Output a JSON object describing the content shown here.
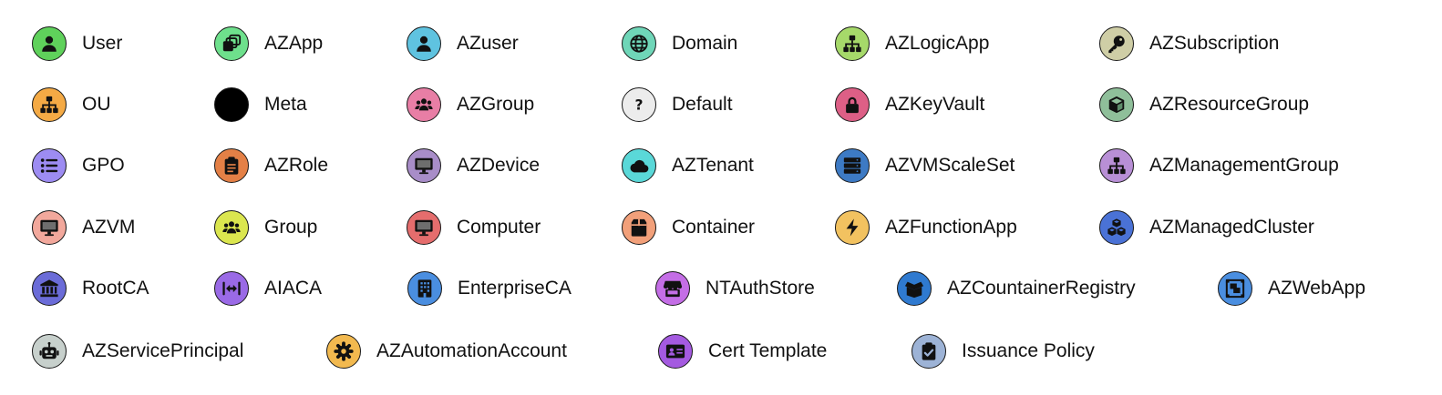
{
  "items": [
    {
      "label": "User",
      "icon": "user-icon",
      "color": "#5fd15b"
    },
    {
      "label": "AZApp",
      "icon": "app-windows-icon",
      "color": "#6ee08c"
    },
    {
      "label": "AZuser",
      "icon": "user-icon",
      "color": "#5fc3e0"
    },
    {
      "label": "Domain",
      "icon": "globe-icon",
      "color": "#6fd6b8"
    },
    {
      "label": "AZLogicApp",
      "icon": "sitemap-icon",
      "color": "#a6d96a"
    },
    {
      "label": "AZSubscription",
      "icon": "key-icon",
      "color": "#cfcea6"
    },
    {
      "label": "OU",
      "icon": "sitemap-icon",
      "color": "#f4aa45"
    },
    {
      "label": "Meta",
      "icon": "none",
      "color": "#000000"
    },
    {
      "label": "AZGroup",
      "icon": "users-icon",
      "color": "#e87ea5"
    },
    {
      "label": "Default",
      "icon": "question-icon",
      "color": "#ececec"
    },
    {
      "label": "AZKeyVault",
      "icon": "lock-icon",
      "color": "#dd5f86"
    },
    {
      "label": "AZResourceGroup",
      "icon": "cube-icon",
      "color": "#8fbf9a"
    },
    {
      "label": "GPO",
      "icon": "list-icon",
      "color": "#9d8cf2"
    },
    {
      "label": "AZRole",
      "icon": "clipboard-icon",
      "color": "#e48046"
    },
    {
      "label": "AZDevice",
      "icon": "desktop-icon",
      "color": "#a88dc8"
    },
    {
      "label": "AZTenant",
      "icon": "cloud-icon",
      "color": "#5ad8d8"
    },
    {
      "label": "AZVMScaleSet",
      "icon": "server-icon",
      "color": "#3d7ac4"
    },
    {
      "label": "AZManagementGroup",
      "icon": "sitemap-icon",
      "color": "#b88fd6"
    },
    {
      "label": "AZVM",
      "icon": "desktop-icon",
      "color": "#f2a89c"
    },
    {
      "label": "Group",
      "icon": "users-icon",
      "color": "#dbe64f"
    },
    {
      "label": "Computer",
      "icon": "desktop-icon",
      "color": "#e56d6d"
    },
    {
      "label": "Container",
      "icon": "box-icon",
      "color": "#f2a07a"
    },
    {
      "label": "AZFunctionApp",
      "icon": "bolt-icon",
      "color": "#f2c260"
    },
    {
      "label": "AZManagedCluster",
      "icon": "cubes-icon",
      "color": "#4a72d6"
    },
    {
      "label": "RootCA",
      "icon": "bank-icon",
      "color": "#6b6cd8"
    },
    {
      "label": "AIACA",
      "icon": "arrows-h-icon",
      "color": "#9a6ae6"
    },
    {
      "label": "EnterpriseCA",
      "icon": "building-icon",
      "color": "#4a8ee0"
    },
    {
      "label": "NTAuthStore",
      "icon": "store-icon",
      "color": "#c46ee6"
    },
    {
      "label": "AZCountainerRegistry",
      "icon": "box-open-icon",
      "color": "#2f7ad0"
    },
    {
      "label": "AZWebApp",
      "icon": "object-group-icon",
      "color": "#4a8ee0"
    },
    {
      "label": "AZServicePrincipal",
      "icon": "robot-icon",
      "color": "#c7d0cc"
    },
    {
      "label": "AZAutomationAccount",
      "icon": "gear-icon",
      "color": "#f2b94f"
    },
    {
      "label": "Cert Template",
      "icon": "id-card-icon",
      "color": "#a45ae0"
    },
    {
      "label": "Issuance Policy",
      "icon": "clipboard-check-icon",
      "color": "#9db3d6"
    }
  ]
}
